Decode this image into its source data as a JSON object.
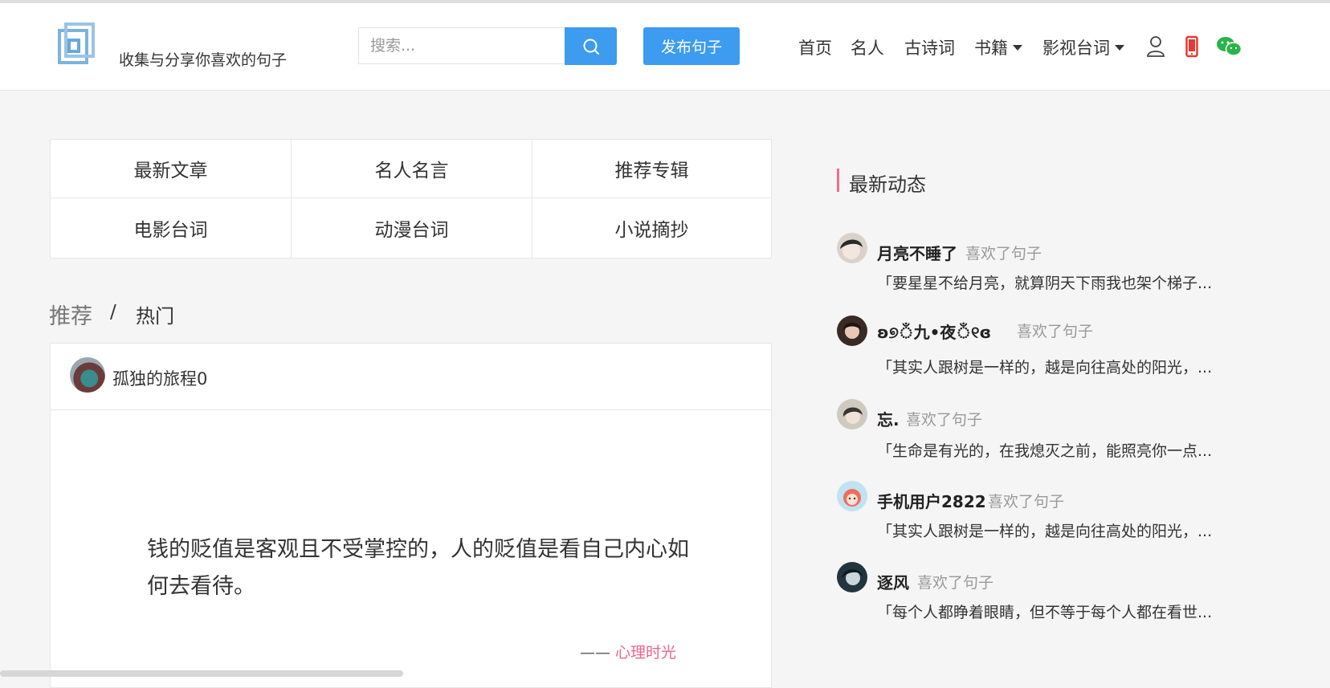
{
  "header": {
    "slogan": "收集与分享你喜欢的句子",
    "search_placeholder": "搜索...",
    "publish_label": "发布句子",
    "nav": {
      "home": "首页",
      "celebrity": "名人",
      "poetry": "古诗词",
      "books": "书籍",
      "movies": "影视台词"
    },
    "icons": [
      "user-icon",
      "phone-icon",
      "wechat-icon"
    ]
  },
  "categories": [
    "最新文章",
    "名人名言",
    "推荐专辑",
    "电影台词",
    "动漫台词",
    "小说摘抄"
  ],
  "tabs": {
    "recommend": "推荐",
    "separator": "/",
    "hot": "热门"
  },
  "post": {
    "author": "孤独的旅程0",
    "quote": "钱的贬值是客观且不受掌控的，人的贬值是看自己内心如何去看待。",
    "attribution_dash": "——",
    "source": "心理时光"
  },
  "sidebar": {
    "title": "最新动态",
    "feed": [
      {
        "user": "月亮不睡了",
        "action": "喜欢了句子",
        "quote": "「要星星不给月亮，就算阴天下雨我也架个梯子..."
      },
      {
        "user": "ʚ୭ঁ九•夜ঁ୧ɞ",
        "action": "喜欢了句子",
        "quote": "「其实人跟树是一样的，越是向往高处的阳光，..."
      },
      {
        "user": "忘.",
        "action": "喜欢了句子",
        "quote": "「生命是有光的，在我熄灭之前，能照亮你一点..."
      },
      {
        "user": "手机用户2822",
        "action": "喜欢了句子",
        "quote": "「其实人跟树是一样的，越是向往高处的阳光，..."
      },
      {
        "user": "逐风",
        "action": "喜欢了句子",
        "quote": "「每个人都睁着眼睛，但不等于每个人都在看世..."
      }
    ]
  },
  "colors": {
    "primary": "#3d9bf0",
    "accent_pink": "#e8668b",
    "phone_red": "#e53935",
    "wechat_green": "#2bb34a"
  }
}
